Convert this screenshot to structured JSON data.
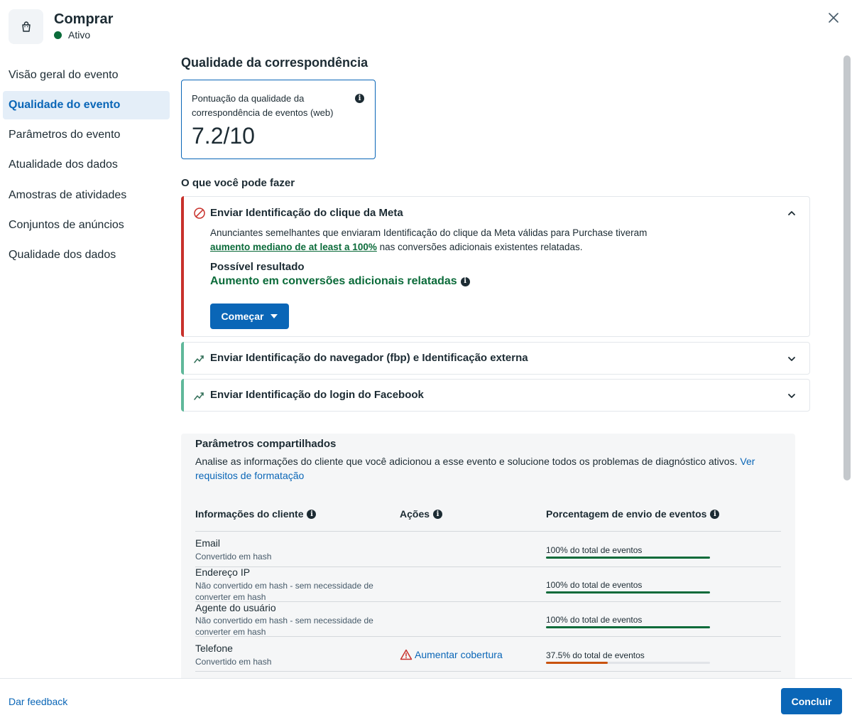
{
  "header": {
    "title": "Comprar",
    "status": "Ativo",
    "status_color": "#0b6b3a",
    "icon": "shopping-bag-icon"
  },
  "sidebar": {
    "items": [
      {
        "label": "Visão geral do evento",
        "active": false
      },
      {
        "label": "Qualidade do evento",
        "active": true
      },
      {
        "label": "Parâmetros do evento",
        "active": false
      },
      {
        "label": "Atualidade dos dados",
        "active": false
      },
      {
        "label": "Amostras de atividades",
        "active": false
      },
      {
        "label": "Conjuntos de anúncios",
        "active": false
      },
      {
        "label": "Qualidade dos dados",
        "active": false
      }
    ]
  },
  "main": {
    "section_title": "Qualidade da correspondência",
    "score": {
      "label": "Pontuação da qualidade da correspondência de eventos (web)",
      "value": "7.2/10"
    },
    "actions_title": "O que você pode fazer",
    "accordions": [
      {
        "title": "Enviar Identificação do clique da Meta",
        "expanded": true,
        "accent": "#c8312b",
        "body_text_1": "Anunciantes semelhantes que enviaram Identificação do clique da Meta válidas para Purchase tiveram",
        "body_link": "aumento mediano de at least a 100%",
        "body_text_2": " nas conversões adicionais existentes relatadas.",
        "result_title": "Possível resultado",
        "result_value": "Aumento em conversões adicionais relatadas",
        "button": "Começar"
      },
      {
        "title": "Enviar Identificação do navegador (fbp) e Identificação externa",
        "expanded": false,
        "accent": "#5fb89a"
      },
      {
        "title": "Enviar Identificação do login do Facebook",
        "expanded": false,
        "accent": "#5fb89a"
      }
    ],
    "shared_params": {
      "title": "Parâmetros compartilhados",
      "description": "Analise as informações do cliente que você adicionou a esse evento e solucione todos os problemas de diagnóstico ativos. ",
      "link": "Ver requisitos de formatação",
      "columns": [
        "Informações do cliente",
        "Ações",
        "Porcentagem de envio de eventos"
      ],
      "rows": [
        {
          "name": "Email",
          "sub": "Convertido em hash",
          "action": "",
          "pct_text": "100% do total de eventos",
          "pct": 1.0,
          "color": "#0b6b3a"
        },
        {
          "name": "Endereço IP",
          "sub": "Não convertido em hash - sem necessidade de converter em hash",
          "action": "",
          "pct_text": "100% do total de eventos",
          "pct": 1.0,
          "color": "#0b6b3a"
        },
        {
          "name": "Agente do usuário",
          "sub": "Não convertido em hash - sem necessidade de converter em hash",
          "action": "",
          "pct_text": "100% do total de eventos",
          "pct": 1.0,
          "color": "#0b6b3a"
        },
        {
          "name": "Telefone",
          "sub": "Convertido em hash",
          "action": "Aumentar cobertura",
          "pct_text": "37.5% do total de eventos",
          "pct": 0.375,
          "color": "#c9530f"
        }
      ]
    }
  },
  "footer": {
    "feedback": "Dar feedback",
    "done": "Concluir"
  },
  "colors": {
    "primary": "#0a66b7",
    "success": "#0b6b3a",
    "warning": "#c8312b"
  }
}
